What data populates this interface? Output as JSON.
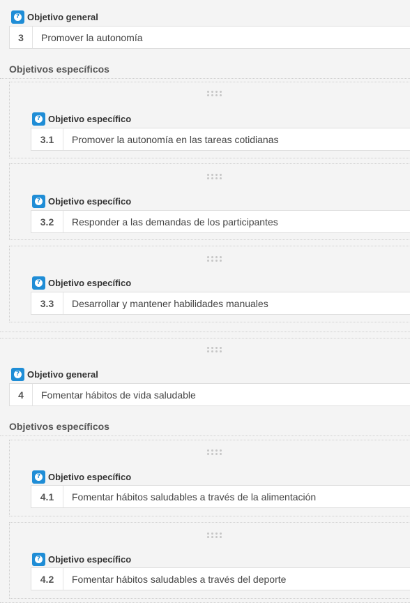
{
  "objectives": [
    {
      "general_label": "Objetivo general",
      "number": "3",
      "text": "Promover la autonomía",
      "section_title": "Objetivos específicos",
      "specific": [
        {
          "label": "Objetivo específico",
          "number": "3.1",
          "text": "Promover la autonomía en las tareas cotidianas"
        },
        {
          "label": "Objetivo específico",
          "number": "3.2",
          "text": "Responder a las demandas de los participantes"
        },
        {
          "label": "Objetivo específico",
          "number": "3.3",
          "text": "Desarrollar y mantener habilidades manuales"
        }
      ]
    },
    {
      "general_label": "Objetivo general",
      "number": "4",
      "text": "Fomentar hábitos de vida saludable",
      "section_title": "Objetivos específicos",
      "specific": [
        {
          "label": "Objetivo específico",
          "number": "4.1",
          "text": "Fomentar hábitos saludables a través de la alimentación"
        },
        {
          "label": "Objetivo específico",
          "number": "4.2",
          "text": "Fomentar hábitos saludables a través del deporte"
        }
      ]
    }
  ],
  "icons": {
    "help": "help-icon",
    "drag": "drag-handle-icon"
  },
  "colors": {
    "accent": "#1f8dd6"
  }
}
